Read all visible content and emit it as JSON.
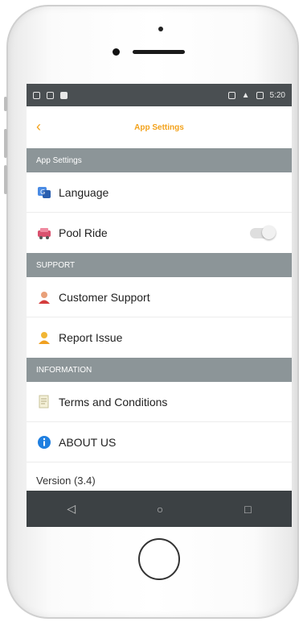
{
  "status_bar": {
    "time": "5:20"
  },
  "app_bar": {
    "back_glyph": "‹",
    "title": "App Settings"
  },
  "sections": {
    "app_settings": "App Settings",
    "support": "SUPPORT",
    "information": "INFORMATION"
  },
  "items": {
    "language": "Language",
    "pool_ride": "Pool Ride",
    "customer_support": "Customer Support",
    "report_issue": "Report Issue",
    "terms": "Terms and Conditions",
    "about": "ABOUT US",
    "version": "Version (3.4)"
  },
  "pool_ride_enabled": false,
  "nav": {
    "back": "◁",
    "home": "○",
    "recents": "□"
  },
  "colors": {
    "accent": "#f3a21b",
    "section_bg": "#8c9598",
    "status_bg": "#4a4f52",
    "nav_bg": "#3c4144"
  }
}
